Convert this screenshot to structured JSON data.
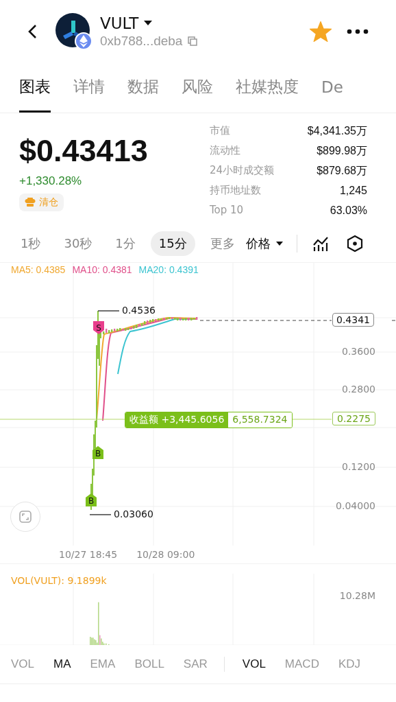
{
  "header": {
    "token": "VULT",
    "address": "0xb788...deba",
    "favorite": true
  },
  "tabs": [
    {
      "label": "图表",
      "selected": true
    },
    {
      "label": "详情",
      "selected": false
    },
    {
      "label": "数据",
      "selected": false
    },
    {
      "label": "风险",
      "selected": false
    },
    {
      "label": "社媒热度",
      "selected": false
    },
    {
      "label": "De",
      "selected": false
    }
  ],
  "price": "$0.43413",
  "change": "+1,330.28%",
  "badge": "清仓",
  "stats": [
    {
      "label": "市值",
      "value": "$4,341.35万"
    },
    {
      "label": "流动性",
      "value": "$899.98万"
    },
    {
      "label": "24小时成交额",
      "value": "$879.68万"
    },
    {
      "label": "持币地址数",
      "value": "1,245"
    },
    {
      "label": "Top 10",
      "value": "63.03%"
    }
  ],
  "intervals": [
    {
      "label": "1秒",
      "selected": false
    },
    {
      "label": "30秒",
      "selected": false
    },
    {
      "label": "1分",
      "selected": false
    },
    {
      "label": "15分",
      "selected": true
    },
    {
      "label": "更多",
      "selected": false
    }
  ],
  "price_mode": "价格",
  "chart": {
    "ma": [
      {
        "label": "MA5: 0.4385",
        "color": "#f0a830"
      },
      {
        "label": "MA10: 0.4381",
        "color": "#e0508a"
      },
      {
        "label": "MA20: 0.4391",
        "color": "#3cc4d0"
      }
    ],
    "high": "0.4536",
    "low": "0.03060",
    "current": "0.4341",
    "yticks": [
      "0.3600",
      "0.2800",
      "0.1200",
      "0.04000"
    ],
    "pnl": {
      "label": "收益额 +3,445.6056",
      "value": "6,558.7324",
      "price": "0.2275"
    },
    "markers": [
      {
        "kind": "sell",
        "label": "S"
      },
      {
        "kind": "buy",
        "label": "B"
      },
      {
        "kind": "buy",
        "label": "B"
      }
    ],
    "times": [
      "10/27 18:45",
      "10/28 09:00"
    ]
  },
  "volume": {
    "label": "VOL(VULT): 9.1899k",
    "max": "10.28M"
  },
  "indicators": {
    "main": [
      {
        "label": "VOL",
        "selected": false
      },
      {
        "label": "MA",
        "selected": true
      },
      {
        "label": "EMA",
        "selected": false
      },
      {
        "label": "BOLL",
        "selected": false
      },
      {
        "label": "SAR",
        "selected": false
      }
    ],
    "sub": [
      {
        "label": "VOL",
        "selected": true
      },
      {
        "label": "MACD",
        "selected": false
      },
      {
        "label": "KDJ",
        "selected": false
      }
    ]
  }
}
